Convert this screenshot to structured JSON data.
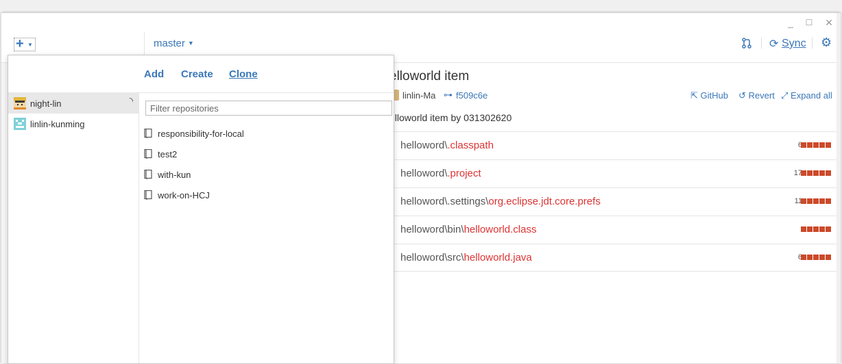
{
  "window": {
    "controls": {
      "minimize": "_",
      "maximize": "☐",
      "close": "✕"
    }
  },
  "toolbar": {
    "add_icon": "plus-icon",
    "branch": "master",
    "sync_label": "Sync"
  },
  "commit": {
    "title": "elloworld item",
    "author": "linlin-Ma",
    "sha": "f509c6e",
    "description": "elloworld item by 031302620",
    "actions": {
      "github": "GitHub",
      "revert": "Revert",
      "expand": "Expand all"
    }
  },
  "files": [
    {
      "dir": "helloword\\",
      "name": ".classpath",
      "count": "6"
    },
    {
      "dir": "helloword\\",
      "name": ".project",
      "count": "17"
    },
    {
      "dir": "helloword\\.settings\\",
      "name": "org.eclipse.jdt.core.prefs",
      "count": "11"
    },
    {
      "dir": "helloword\\bin\\",
      "name": "helloworld.class",
      "count": ""
    },
    {
      "dir": "helloword\\src\\",
      "name": "helloworld.java",
      "count": "6"
    }
  ],
  "popup": {
    "tabs": [
      {
        "label": "Add",
        "active": false
      },
      {
        "label": "Create",
        "active": false
      },
      {
        "label": "Clone",
        "active": true
      }
    ],
    "accounts": [
      {
        "label": "night-lin",
        "selected": true
      },
      {
        "label": "linlin-kunming",
        "selected": false
      }
    ],
    "filter_placeholder": "Filter repositories",
    "repos": [
      {
        "label": "responsibility-for-local"
      },
      {
        "label": "test2"
      },
      {
        "label": "with-kun"
      },
      {
        "label": "work-on-HCJ"
      }
    ]
  },
  "colors": {
    "accent": "#3a77b8",
    "diff_block": "#cc4a2a",
    "filename": "#dd3333"
  }
}
